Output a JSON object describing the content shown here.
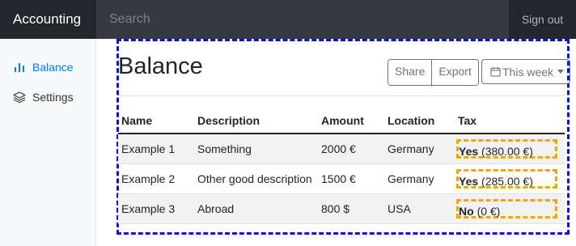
{
  "navbar": {
    "brand": "Accounting",
    "search_placeholder": "Search",
    "signout": "Sign out"
  },
  "sidebar": {
    "items": [
      {
        "label": "Balance",
        "icon": "bar-chart-icon",
        "active": true
      },
      {
        "label": "Settings",
        "icon": "layers-icon",
        "active": false
      }
    ]
  },
  "main": {
    "title": "Balance",
    "buttons": {
      "share": "Share",
      "export": "Export"
    },
    "period": "This week",
    "table": {
      "headers": [
        "Name",
        "Description",
        "Amount",
        "Location",
        "Tax"
      ],
      "rows": [
        {
          "name": "Example 1",
          "description": "Something",
          "amount": "2000 €",
          "location": "Germany",
          "tax_flag": "Yes",
          "tax_amount": "(380.00 €)"
        },
        {
          "name": "Example 2",
          "description": "Other good description",
          "amount": "1500 €",
          "location": "Germany",
          "tax_flag": "Yes",
          "tax_amount": "(285.00 €)"
        },
        {
          "name": "Example 3",
          "description": "Abroad",
          "amount": "800 $",
          "location": "USA",
          "tax_flag": "No",
          "tax_amount": "(0 €)"
        }
      ]
    }
  },
  "colors": {
    "accent": "#007bff",
    "navbar": "#343a40",
    "highlight_blue": "#0a10e6",
    "highlight_orange": "#f0a800"
  }
}
